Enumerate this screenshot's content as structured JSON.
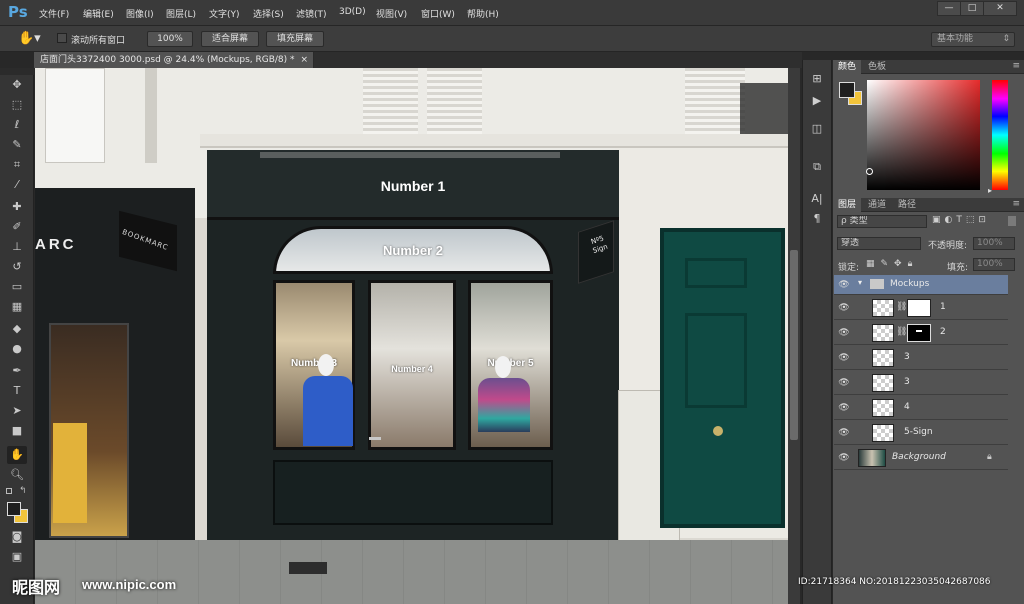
{
  "app": {
    "logo": "Ps"
  },
  "menu": [
    "文件(F)",
    "编辑(E)",
    "图像(I)",
    "图层(L)",
    "文字(Y)",
    "选择(S)",
    "滤镜(T)",
    "3D(D)",
    "视图(V)",
    "窗口(W)",
    "帮助(H)"
  ],
  "window_controls": {
    "minimize": "—",
    "restore": "□",
    "close": "✕"
  },
  "options": {
    "tool_icon": "hand-icon",
    "scroll_all_label": "滚动所有窗口",
    "zoom_100": "100%",
    "fit_screen": "适合屏幕",
    "fill_screen": "填充屏幕",
    "workspace": "基本功能"
  },
  "document": {
    "tab_title": "店面门头3372400 3000.psd @ 24.4% (Mockups, RGB/8) *",
    "close": "×"
  },
  "canvas_text": {
    "sign1": "Number 1",
    "sign2": "Number 2",
    "sign3": "Number 3",
    "sign4": "Number 4",
    "sign5": "Number 5",
    "blade_sign": "Nº5 Sign",
    "neighbor_sign": "ARC",
    "neighbor_blade": "BOOKMARC"
  },
  "color_panel": {
    "tabs": [
      "颜色",
      "色板"
    ],
    "fg": "#1f1f1f",
    "bg": "#f2c43b"
  },
  "layers_panel": {
    "tabs": [
      "图层",
      "通道",
      "路径"
    ],
    "filter": "ρ 类型",
    "blend": "穿透",
    "opacity_label": "不透明度:",
    "opacity": "100%",
    "lock_label": "锁定:",
    "fill_label": "填充:",
    "fill": "100%",
    "layers": [
      {
        "name": "Mockups",
        "type": "group"
      },
      {
        "name": "1",
        "type": "smart",
        "mask": "white"
      },
      {
        "name": "2",
        "type": "smart",
        "mask": "black"
      },
      {
        "name": "3",
        "type": "smart"
      },
      {
        "name": "3",
        "type": "smart"
      },
      {
        "name": "4",
        "type": "smart"
      },
      {
        "name": "5-Sign",
        "type": "smart"
      },
      {
        "name": "Background",
        "type": "background",
        "locked": true
      }
    ]
  },
  "watermark": {
    "logo": "昵图网",
    "url": "www.nipic.com",
    "id": "ID:21718364 NO:20181223035042687086"
  }
}
